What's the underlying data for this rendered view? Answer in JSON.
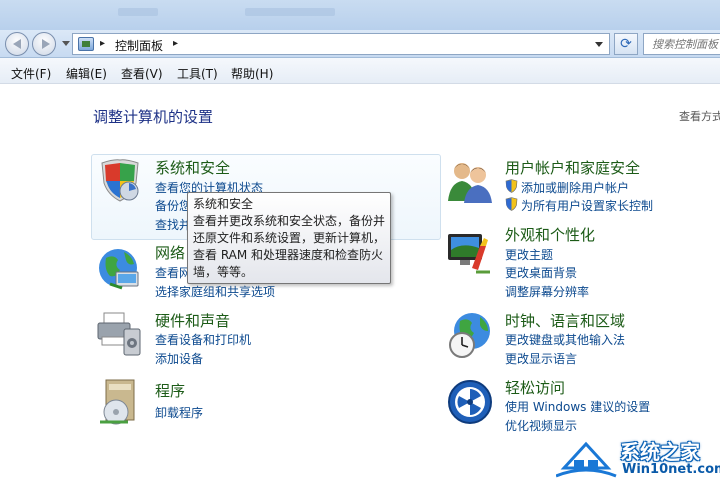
{
  "address": {
    "breadcrumb": "控制面板",
    "search_placeholder": "搜索控制面板"
  },
  "menu": [
    "文件(F)",
    "编辑(E)",
    "查看(V)",
    "工具(T)",
    "帮助(H)"
  ],
  "page_title": "调整计算机的设置",
  "view_by": "查看方式",
  "categories": {
    "system_security": {
      "title": "系统和安全",
      "links": [
        "查看您的计算机状态",
        "备份您",
        "查找并"
      ]
    },
    "network": {
      "title": "网络",
      "links": [
        "查看网",
        "选择家庭组和共享选项"
      ]
    },
    "hardware": {
      "title": "硬件和声音",
      "links": [
        "查看设备和打印机",
        "添加设备"
      ]
    },
    "programs": {
      "title": "程序",
      "links": [
        "卸载程序"
      ]
    },
    "user_accounts": {
      "title": "用户帐户和家庭安全",
      "links": [
        "添加或删除用户帐户",
        "为所有用户设置家长控制"
      ]
    },
    "appearance": {
      "title": "外观和个性化",
      "links": [
        "更改主题",
        "更改桌面背景",
        "调整屏幕分辨率"
      ]
    },
    "clock": {
      "title": "时钟、语言和区域",
      "links": [
        "更改键盘或其他输入法",
        "更改显示语言"
      ]
    },
    "ease": {
      "title": "轻松访问",
      "links": [
        "使用 Windows 建议的设置",
        "优化视频显示"
      ]
    }
  },
  "tooltip": {
    "title": "系统和安全",
    "lines": [
      "查看并更改系统和安全状态，备份并",
      "还原文件和系统设置，更新计算机，",
      "查看 RAM 和处理器速度和检查防火",
      "墙，等等。"
    ]
  },
  "watermark": {
    "title": "系统之家",
    "url": "Win10net.com"
  },
  "colors": {
    "category_title": "#1c5b17",
    "link": "#0d4a8f",
    "page_title": "#1e3287"
  }
}
